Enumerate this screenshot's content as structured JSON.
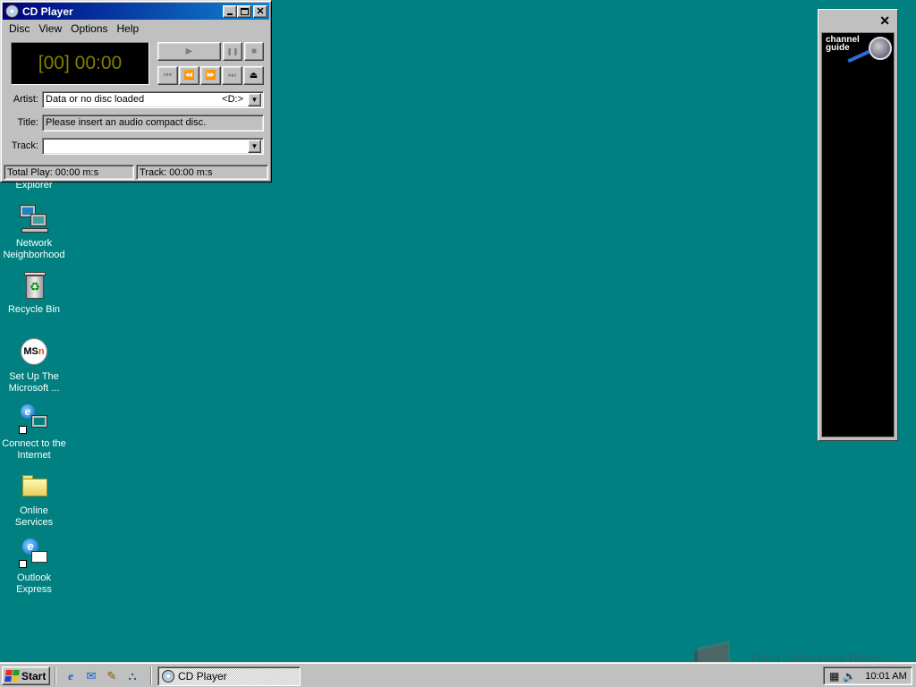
{
  "desktop": {
    "icons": [
      {
        "label": "Explorer"
      },
      {
        "label": "Network Neighborhood"
      },
      {
        "label": "Recycle Bin"
      },
      {
        "label": "Set Up The Microsoft ..."
      },
      {
        "label": "Connect to the Internet"
      },
      {
        "label": "Online Services"
      },
      {
        "label": "Outlook Express"
      }
    ],
    "background_color": "#008080"
  },
  "cdplayer": {
    "title": "CD Player",
    "menu": [
      "Disc",
      "View",
      "Options",
      "Help"
    ],
    "display": "[00] 00:00",
    "artist_label": "Artist:",
    "artist_value": "Data or no disc loaded",
    "drive": "<D:>",
    "title_label": "Title:",
    "title_value": "Please insert an audio compact disc.",
    "track_label": "Track:",
    "track_value": "",
    "status_total": "Total Play: 00:00 m:s",
    "status_track": "Track: 00:00 m:s",
    "buttons": {
      "play": "▶",
      "pause": "❚❚",
      "stop": "■",
      "prev": "⏮",
      "rewind": "⏪",
      "forward": "⏩",
      "next": "⏭",
      "eject": "⏏"
    }
  },
  "channel_bar": {
    "close": "✕",
    "guide_line1": "channel",
    "guide_line2": "guide"
  },
  "taskbar": {
    "start_label": "Start",
    "task_label": "CD Player",
    "clock": "10:01 AM"
  },
  "watermark": "The Collection Book"
}
